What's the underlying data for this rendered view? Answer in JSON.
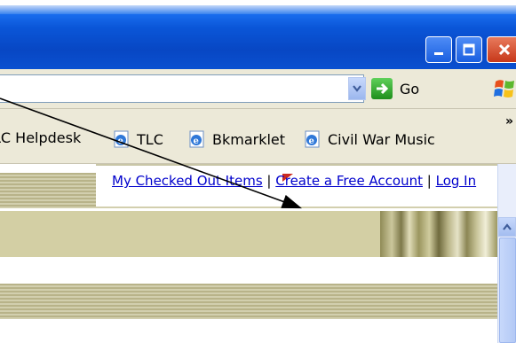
{
  "window": {
    "buttons": {
      "minimize": "minimize",
      "maximize": "maximize",
      "close": "close"
    }
  },
  "toolbar": {
    "go_label": "Go",
    "more_links": "»"
  },
  "links_bar": {
    "items": [
      {
        "label": "LC Helpdesk",
        "icon": "ie-page-icon"
      },
      {
        "label": "TLC",
        "icon": "ie-page-icon"
      },
      {
        "label": "Bkmarklet",
        "icon": "ie-page-icon"
      },
      {
        "label": "Civil War Music",
        "icon": "ie-page-icon"
      }
    ]
  },
  "page_nav": {
    "checked_out": "My Checked Out Items",
    "separator": "|",
    "create_account": "Create a Free Account",
    "log_in": "Log In"
  },
  "colors": {
    "titlebar_blue": "#0a56d8",
    "chrome_beige": "#ece9d8",
    "stripe_olive": "#b8b389",
    "band_olive": "#d3cfa4",
    "link_blue": "#0000cc",
    "close_red": "#c7381a",
    "go_green": "#1f8f1c"
  }
}
